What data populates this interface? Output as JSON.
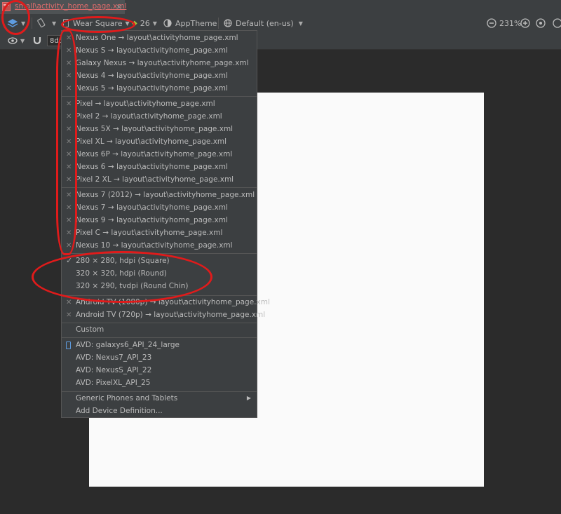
{
  "tab": {
    "label": "small\\activity_home_page.xml",
    "close": "×"
  },
  "toolbar": {
    "device": "Wear Square",
    "api": "26",
    "theme": "AppTheme",
    "locale": "Default (en-us)",
    "zoom": "231%"
  },
  "toolbar2": {
    "margin": "8dp"
  },
  "menu": {
    "group1": [
      "Nexus One → layout\\activityhome_page.xml",
      "Nexus S → layout\\activityhome_page.xml",
      "Galaxy Nexus → layout\\activityhome_page.xml",
      "Nexus 4 → layout\\activityhome_page.xml",
      "Nexus 5 → layout\\activityhome_page.xml"
    ],
    "group2": [
      "Pixel → layout\\activityhome_page.xml",
      "Pixel 2 → layout\\activityhome_page.xml",
      "Nexus 5X → layout\\activityhome_page.xml",
      "Pixel XL → layout\\activityhome_page.xml",
      "Nexus 6P → layout\\activityhome_page.xml",
      "Nexus 6 → layout\\activityhome_page.xml",
      "Pixel 2 XL → layout\\activityhome_page.xml"
    ],
    "group3": [
      "Nexus 7 (2012) → layout\\activityhome_page.xml",
      "Nexus 7 → layout\\activityhome_page.xml",
      "Nexus 9 → layout\\activityhome_page.xml",
      "Pixel C → layout\\activityhome_page.xml",
      "Nexus 10 → layout\\activityhome_page.xml"
    ],
    "wear": [
      "280 × 280, hdpi (Square)",
      "320 × 320, hdpi (Round)",
      "320 × 290, tvdpi (Round Chin)"
    ],
    "tv": [
      "Android TV (1080p) → layout\\activityhome_page.xml",
      "Android TV (720p) → layout\\activityhome_page.xml"
    ],
    "custom": "Custom",
    "avd": [
      "AVD: galaxys6_API_24_large",
      "AVD: Nexus7_API_23",
      "AVD: NexusS_API_22",
      "AVD: PixelXL_API_25"
    ],
    "generic": "Generic Phones and Tablets",
    "add_device": "Add Device Definition..."
  },
  "colors": {
    "annotation": "#e01b1b",
    "bg": "#2b2b2b",
    "menu_bg": "#3c3f41",
    "canvas": "#fafafa"
  }
}
